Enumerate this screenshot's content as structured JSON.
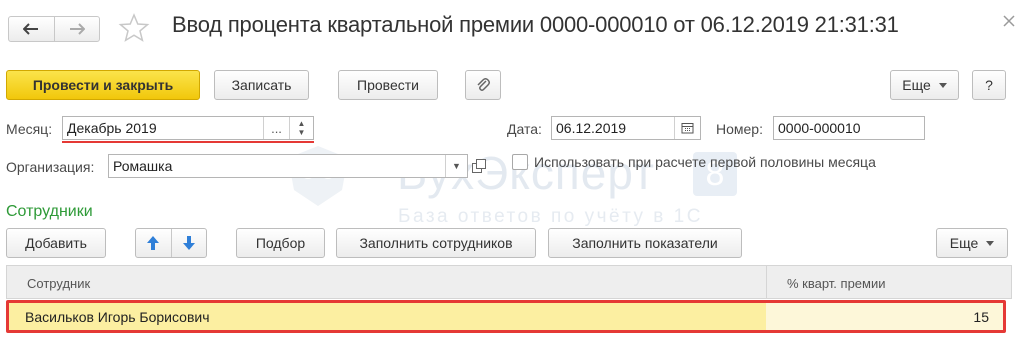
{
  "window": {
    "title": "Ввод процента квартальной премии 0000-000010 от 06.12.2019 21:31:31"
  },
  "toolbar": {
    "post_and_close": "Провести и закрыть",
    "save": "Записать",
    "post": "Провести",
    "more": "Еще",
    "help": "?"
  },
  "form": {
    "month_label": "Месяц:",
    "month_value": "Декабрь 2019",
    "month_select": "...",
    "date_label": "Дата:",
    "date_value": "06.12.2019",
    "number_label": "Номер:",
    "number_value": "0000-000010",
    "org_label": "Организация:",
    "org_value": "Ромашка",
    "first_half_checkbox_label": "Использовать при расчете первой половины месяца",
    "first_half_checked": false
  },
  "watermark": {
    "brand": "БухЭксперт",
    "brand_num": "8",
    "tagline": "База ответов по учёту в 1С"
  },
  "employees": {
    "section_title": "Сотрудники",
    "toolbar": {
      "add": "Добавить",
      "pick": "Подбор",
      "fill_employees": "Заполнить сотрудников",
      "fill_values": "Заполнить показатели",
      "more": "Еще"
    },
    "columns": [
      "Сотрудник",
      "% кварт. премии"
    ],
    "rows": [
      {
        "employee": "Васильков Игорь Борисович",
        "bonus_percent": "15"
      }
    ]
  },
  "colors": {
    "primary_button": "#f5d223",
    "highlight_border": "#e53935",
    "section_title": "#2e9a37",
    "selected_row": "#fcefa1"
  }
}
